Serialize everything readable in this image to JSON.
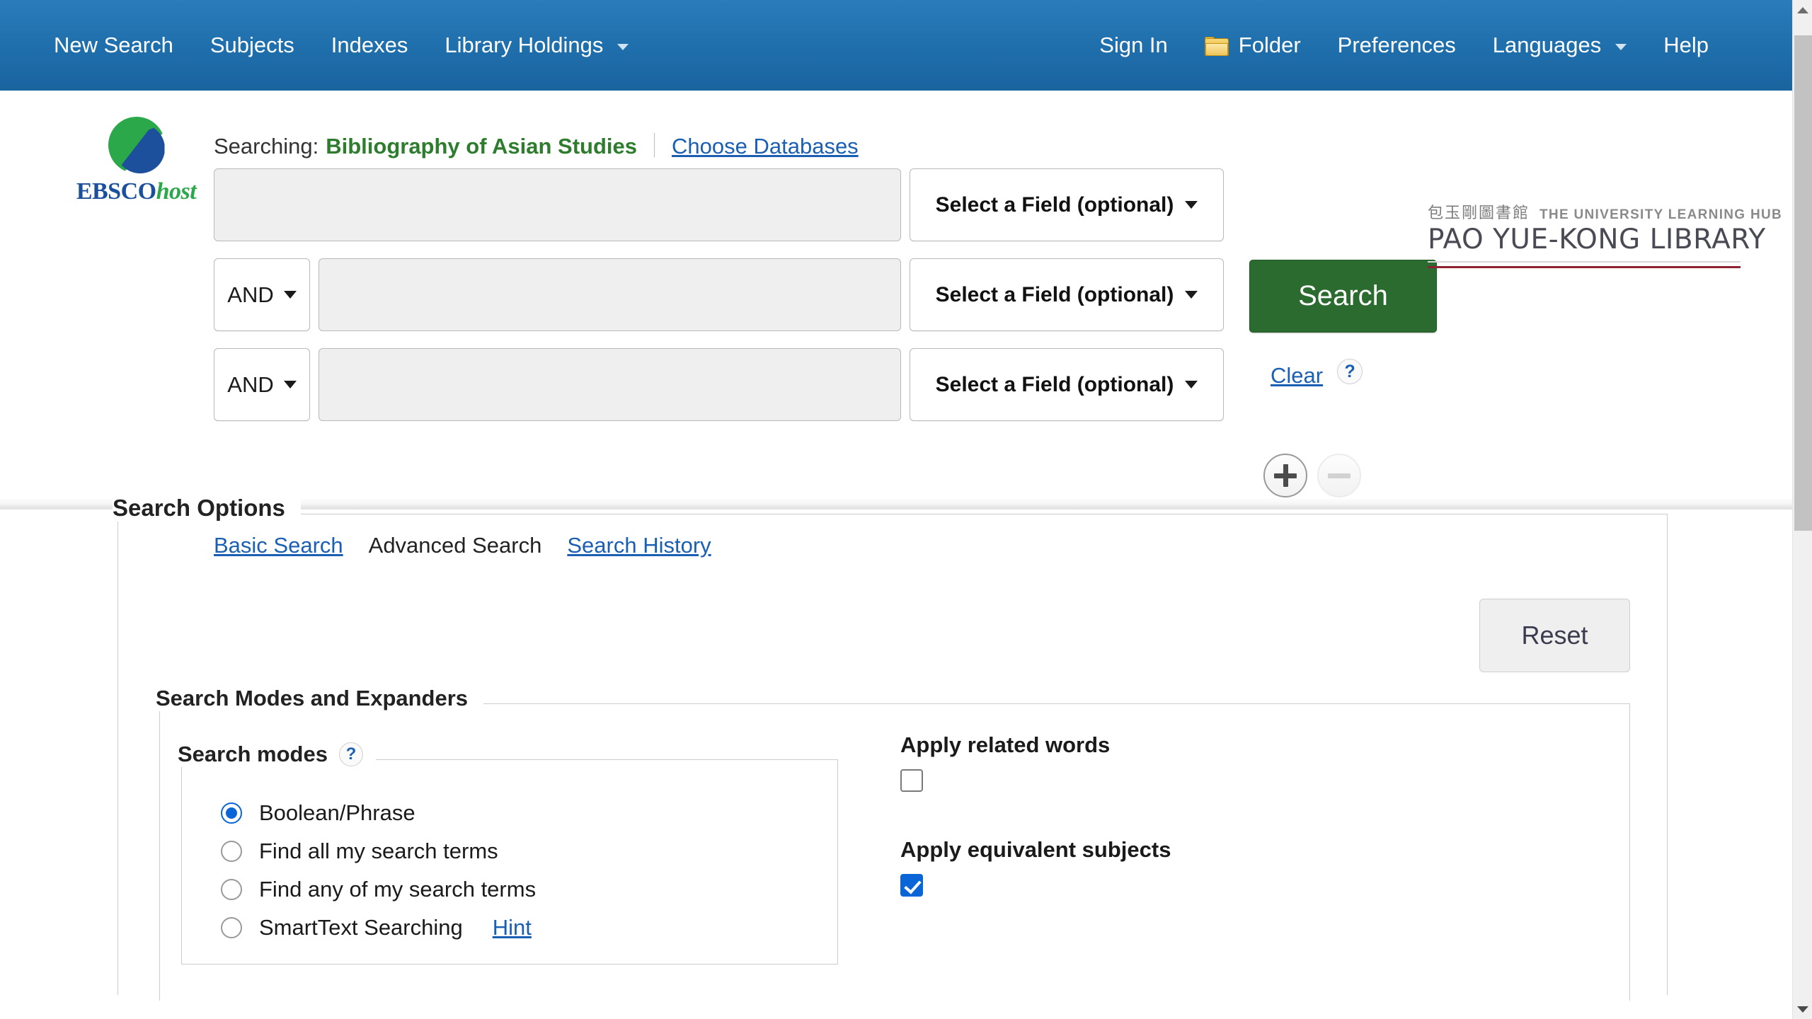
{
  "topnav": {
    "left_items": [
      {
        "label": "New Search",
        "icon": null,
        "caret": false
      },
      {
        "label": "Subjects",
        "icon": null,
        "caret": false
      },
      {
        "label": "Indexes",
        "icon": null,
        "caret": false
      },
      {
        "label": "Library Holdings",
        "icon": null,
        "caret": true
      }
    ],
    "right_items": [
      {
        "label": "Sign In",
        "icon": null,
        "caret": false
      },
      {
        "label": "Folder",
        "icon": "folder-icon",
        "caret": false
      },
      {
        "label": "Preferences",
        "icon": null,
        "caret": false
      },
      {
        "label": "Languages",
        "icon": null,
        "caret": true
      },
      {
        "label": "Help",
        "icon": null,
        "caret": false
      }
    ],
    "background_color": "#1f6eac",
    "text_color": "#ffffff"
  },
  "brand": {
    "ebsco": {
      "part1": "EBSCO",
      "part2": "host",
      "green": "#2aa84a",
      "blue": "#1c4f9c"
    },
    "library": {
      "chinese": "包玉剛圖書館",
      "tagline": "THE UNIVERSITY LEARNING HUB",
      "name": "PAO YUE-KONG LIBRARY",
      "rule_color": "#8f2230"
    }
  },
  "searching": {
    "label": "Searching:",
    "database": "Bibliography of Asian Studies",
    "choose_db_link": "Choose Databases",
    "database_color": "#2e7d2e",
    "link_color": "#1a5fb4"
  },
  "search_form": {
    "rows": [
      {
        "boolean": null,
        "term": "",
        "placeholder": "",
        "field": "Select a Field (optional)"
      },
      {
        "boolean": "AND",
        "term": "",
        "placeholder": "",
        "field": "Select a Field (optional)"
      },
      {
        "boolean": "AND",
        "term": "",
        "placeholder": "",
        "field": "Select a Field (optional)"
      }
    ],
    "search_button": "Search",
    "search_button_color": "#2c6b2f",
    "clear_link": "Clear",
    "help_icon": "?",
    "add_row_icon": "plus-icon",
    "remove_row_icon": "minus-icon"
  },
  "mode_links": [
    {
      "label": "Basic Search",
      "active": false
    },
    {
      "label": "Advanced Search",
      "active": true
    },
    {
      "label": "Search History",
      "active": false
    }
  ],
  "search_options": {
    "legend": "Search Options",
    "reset_button": "Reset",
    "modes_legend": "Search Modes and Expanders",
    "search_modes_legend": "Search modes",
    "search_modes_help": "?",
    "modes": [
      {
        "label": "Boolean/Phrase",
        "checked": true,
        "hint": null
      },
      {
        "label": "Find all my search terms",
        "checked": false,
        "hint": null
      },
      {
        "label": "Find any of my search terms",
        "checked": false,
        "hint": null
      },
      {
        "label": "SmartText Searching",
        "checked": false,
        "hint": "Hint"
      }
    ],
    "expanders": [
      {
        "label": "Apply related words",
        "checked": false
      },
      {
        "label": "Apply equivalent subjects",
        "checked": true
      }
    ]
  },
  "scrollbar": {
    "up_arrow": "scroll-up-icon",
    "down_arrow": "scroll-down-icon"
  }
}
